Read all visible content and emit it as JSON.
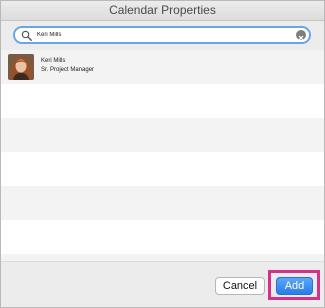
{
  "window": {
    "title": "Calendar Properties"
  },
  "search": {
    "value": "Keri Mills"
  },
  "results": [
    {
      "name": "Keri Mills",
      "title": "Sr. Project Manager"
    }
  ],
  "footer": {
    "cancel_label": "Cancel",
    "add_label": "Add"
  },
  "colors": {
    "accent_blue": "#2a7de8",
    "highlight_pink": "#d6318a",
    "search_focus": "#6aa4ea"
  },
  "icons": [
    "search-icon",
    "clear-icon",
    "avatar"
  ]
}
